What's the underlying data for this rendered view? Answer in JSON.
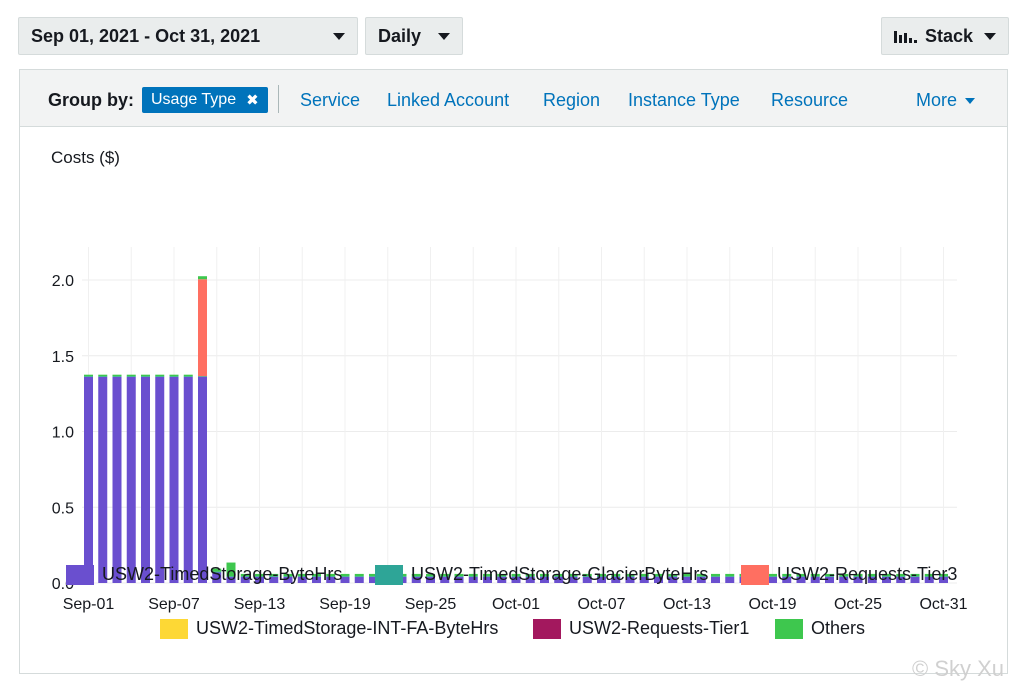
{
  "controls": {
    "date_range": "Sep 01, 2021 - Oct 31, 2021",
    "granularity": "Daily",
    "chart_style": "Stack"
  },
  "groupby": {
    "label": "Group by:",
    "active": "Usage Type",
    "options": [
      "Service",
      "Linked Account",
      "Region",
      "Instance Type",
      "Resource"
    ],
    "more": "More"
  },
  "watermark": "© Sky Xu",
  "chart_data": {
    "type": "bar",
    "stacked": true,
    "ylabel": "Costs ($)",
    "ylim": [
      0,
      2.0
    ],
    "yticks": [
      "0.0",
      "0.5",
      "1.0",
      "1.5",
      "2.0"
    ],
    "xtick_labels": [
      "Sep-01",
      "Sep-07",
      "Sep-13",
      "Sep-19",
      "Sep-25",
      "Oct-01",
      "Oct-07",
      "Oct-13",
      "Oct-19",
      "Oct-25",
      "Oct-31"
    ],
    "grid": true,
    "legend_position": "bottom",
    "categories": [
      "Sep-01",
      "Sep-02",
      "Sep-03",
      "Sep-04",
      "Sep-05",
      "Sep-06",
      "Sep-07",
      "Sep-08",
      "Sep-09",
      "Sep-10",
      "Sep-11",
      "Sep-12",
      "Sep-13",
      "Sep-14",
      "Sep-15",
      "Sep-16",
      "Sep-17",
      "Sep-18",
      "Sep-19",
      "Sep-20",
      "Sep-21",
      "Sep-22",
      "Sep-23",
      "Sep-24",
      "Sep-25",
      "Sep-26",
      "Sep-27",
      "Sep-28",
      "Sep-29",
      "Sep-30",
      "Oct-01",
      "Oct-02",
      "Oct-03",
      "Oct-04",
      "Oct-05",
      "Oct-06",
      "Oct-07",
      "Oct-08",
      "Oct-09",
      "Oct-10",
      "Oct-11",
      "Oct-12",
      "Oct-13",
      "Oct-14",
      "Oct-15",
      "Oct-16",
      "Oct-17",
      "Oct-18",
      "Oct-19",
      "Oct-20",
      "Oct-21",
      "Oct-22",
      "Oct-23",
      "Oct-24",
      "Oct-25",
      "Oct-26",
      "Oct-27",
      "Oct-28",
      "Oct-29",
      "Oct-30",
      "Oct-31"
    ],
    "series": [
      {
        "name": "USW2-TimedStorage-ByteHrs",
        "color": "#6a4fcf",
        "values": [
          1.36,
          1.36,
          1.36,
          1.36,
          1.36,
          1.36,
          1.36,
          1.36,
          1.36,
          0.07,
          0.04,
          0.04,
          0.04,
          0.04,
          0.04,
          0.04,
          0.04,
          0.04,
          0.04,
          0.04,
          0.04,
          0.04,
          0.04,
          0.04,
          0.04,
          0.04,
          0.04,
          0.04,
          0.04,
          0.04,
          0.04,
          0.04,
          0.04,
          0.04,
          0.04,
          0.04,
          0.04,
          0.04,
          0.04,
          0.04,
          0.04,
          0.04,
          0.04,
          0.04,
          0.04,
          0.04,
          0.04,
          0.04,
          0.04,
          0.04,
          0.04,
          0.04,
          0.04,
          0.04,
          0.04,
          0.04,
          0.04,
          0.04,
          0.04,
          0.04,
          0.04
        ]
      },
      {
        "name": "USW2-TimedStorage-GlacierByteHrs",
        "color": "#2ea597",
        "values": [
          0.005,
          0.005,
          0.005,
          0.005,
          0.005,
          0.005,
          0.005,
          0.005,
          0.005,
          0.005,
          0.005,
          0.005,
          0.005,
          0.005,
          0.005,
          0.005,
          0.005,
          0.005,
          0.005,
          0.005,
          0.005,
          0.005,
          0.005,
          0.005,
          0.005,
          0.005,
          0.005,
          0.005,
          0.005,
          0.005,
          0.005,
          0.005,
          0.005,
          0.005,
          0.005,
          0.005,
          0.005,
          0.005,
          0.005,
          0.005,
          0.005,
          0.005,
          0.005,
          0.005,
          0.005,
          0.005,
          0.005,
          0.005,
          0.005,
          0.005,
          0.005,
          0.005,
          0.005,
          0.005,
          0.005,
          0.005,
          0.005,
          0.005,
          0.005,
          0.005,
          0.005
        ]
      },
      {
        "name": "USW2-Requests-Tier3",
        "color": "#ff6f61",
        "values": [
          0,
          0,
          0,
          0,
          0,
          0,
          0,
          0,
          0.64,
          0,
          0,
          0,
          0,
          0,
          0,
          0,
          0,
          0,
          0,
          0,
          0,
          0,
          0,
          0,
          0,
          0,
          0,
          0,
          0,
          0,
          0,
          0,
          0,
          0,
          0,
          0,
          0,
          0,
          0,
          0,
          0,
          0,
          0,
          0,
          0,
          0,
          0,
          0,
          0,
          0,
          0,
          0,
          0,
          0,
          0,
          0,
          0,
          0,
          0,
          0,
          0
        ]
      },
      {
        "name": "USW2-TimedStorage-INT-FA-ByteHrs",
        "color": "#fdd835",
        "values": [
          0,
          0,
          0,
          0,
          0,
          0,
          0,
          0,
          0,
          0,
          0,
          0,
          0,
          0,
          0,
          0,
          0,
          0,
          0,
          0,
          0,
          0,
          0,
          0,
          0,
          0,
          0,
          0,
          0,
          0,
          0,
          0,
          0,
          0,
          0,
          0,
          0,
          0,
          0,
          0,
          0,
          0,
          0,
          0,
          0,
          0,
          0,
          0,
          0,
          0,
          0,
          0,
          0,
          0,
          0,
          0,
          0,
          0,
          0,
          0,
          0
        ]
      },
      {
        "name": "USW2-Requests-Tier1",
        "color": "#a3185e",
        "values": [
          0,
          0,
          0,
          0,
          0,
          0,
          0,
          0,
          0,
          0,
          0,
          0,
          0,
          0,
          0,
          0,
          0,
          0,
          0,
          0,
          0,
          0,
          0,
          0,
          0,
          0,
          0,
          0,
          0,
          0,
          0,
          0,
          0,
          0,
          0,
          0,
          0,
          0,
          0,
          0,
          0,
          0,
          0,
          0,
          0,
          0,
          0,
          0,
          0,
          0,
          0,
          0,
          0,
          0,
          0,
          0,
          0,
          0,
          0,
          0,
          0
        ]
      },
      {
        "name": "Others",
        "color": "#3ec74e",
        "values": [
          0.01,
          0.01,
          0.01,
          0.01,
          0.01,
          0.01,
          0.01,
          0.01,
          0.02,
          0.02,
          0.09,
          0.015,
          0.015,
          0.015,
          0.015,
          0.015,
          0.015,
          0.015,
          0.015,
          0.015,
          0.015,
          0.015,
          0.015,
          0.015,
          0.015,
          0.015,
          0.015,
          0.015,
          0.015,
          0.015,
          0.015,
          0.015,
          0.015,
          0.015,
          0.015,
          0.015,
          0.015,
          0.015,
          0.015,
          0.015,
          0.015,
          0.015,
          0.015,
          0.015,
          0.015,
          0.015,
          0.015,
          0.015,
          0.015,
          0.015,
          0.015,
          0.015,
          0.015,
          0.015,
          0.015,
          0.015,
          0.015,
          0.015,
          0.015,
          0.015,
          0.015
        ]
      }
    ]
  }
}
